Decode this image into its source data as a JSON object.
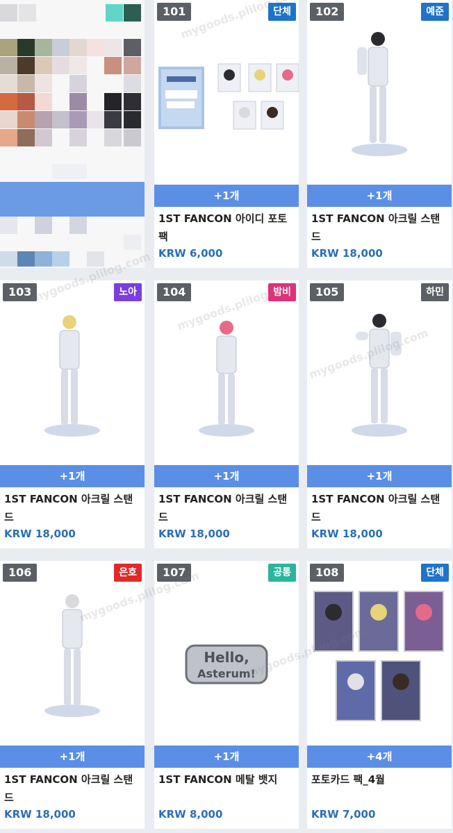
{
  "items": [
    {
      "num": "101",
      "tag": "단체",
      "tag_color": "#1f73c9",
      "qty": "+1개",
      "title": "1ST FANCON 아이디 포토팩",
      "price": "KRW 6,000",
      "image": "id-photo-pack"
    },
    {
      "num": "102",
      "tag": "예준",
      "tag_color": "#1f73c9",
      "qty": "+1개",
      "title": "1ST FANCON 아크릴 스탠드",
      "price": "KRW 18,000",
      "image": "acrylic-stand"
    },
    {
      "num": "103",
      "tag": "노아",
      "tag_color": "#7a3fe0",
      "qty": "+1개",
      "title": "1ST FANCON 아크릴 스탠드",
      "price": "KRW 18,000",
      "image": "acrylic-stand"
    },
    {
      "num": "104",
      "tag": "밤비",
      "tag_color": "#e0307a",
      "qty": "+1개",
      "title": "1ST FANCON 아크릴 스탠드",
      "price": "KRW 18,000",
      "image": "acrylic-stand"
    },
    {
      "num": "105",
      "tag": "하민",
      "tag_color": "#5b5f66",
      "qty": "+1개",
      "title": "1ST FANCON 아크릴 스탠드",
      "price": "KRW 18,000",
      "image": "acrylic-stand"
    },
    {
      "num": "106",
      "tag": "은호",
      "tag_color": "#e02a2a",
      "qty": "+1개",
      "title": "1ST FANCON 아크릴 스탠드",
      "price": "KRW 18,000",
      "image": "acrylic-stand"
    },
    {
      "num": "107",
      "tag": "공통",
      "tag_color": "#2bb59a",
      "qty": "+1개",
      "title": "1ST FANCON 메탈 뱃지",
      "price": "KRW 8,000",
      "image": "metal-badge"
    },
    {
      "num": "108",
      "tag": "단체",
      "tag_color": "#1f73c9",
      "qty": "+4개",
      "title": "포토카드 팩_4월",
      "price": "KRW 7,000",
      "image": "photocard-pack"
    }
  ],
  "badge_text_1": "Hello,",
  "badge_text_2": "Asterum!",
  "watermark": "mygoods.plilog.com"
}
